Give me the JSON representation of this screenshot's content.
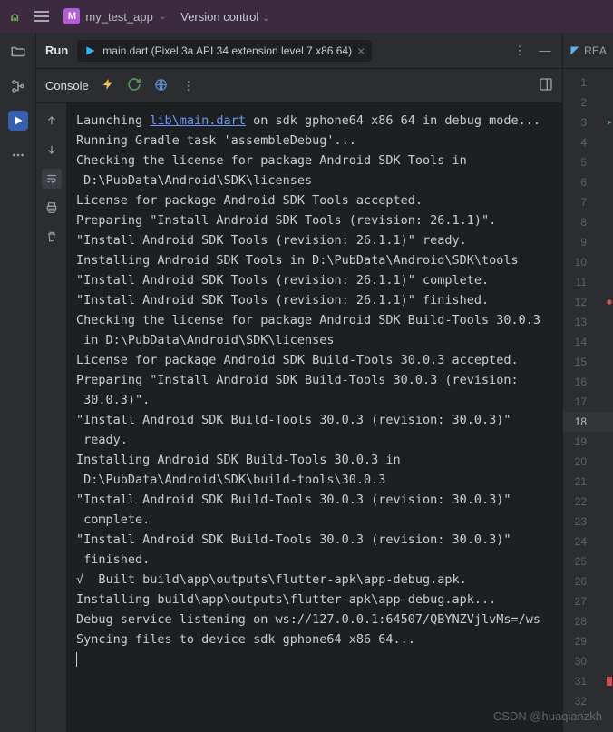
{
  "topbar": {
    "project_initial": "M",
    "project_name": "my_test_app",
    "version_control": "Version control"
  },
  "tab": {
    "run_label": "Run",
    "file_label": "main.dart (Pixel 3a API 34 extension level 7 x86 64)"
  },
  "subbar": {
    "console_label": "Console"
  },
  "right": {
    "header": "REA"
  },
  "gutter": {
    "lines": [
      "1",
      "2",
      "3",
      "4",
      "5",
      "6",
      "7",
      "8",
      "9",
      "10",
      "11",
      "12",
      "13",
      "14",
      "15",
      "16",
      "17",
      "18",
      "19",
      "20",
      "21",
      "22",
      "23",
      "24",
      "25",
      "26",
      "27",
      "28",
      "29",
      "30",
      "31",
      "32"
    ],
    "highlight": 18,
    "run_marker_at": 3,
    "breakpoint_at": 12,
    "red_marker_at": 31
  },
  "console": {
    "link_text": "lib\\main.dart",
    "pre_link": "Launching ",
    "post_link": " on sdk gphone64 x86 64 in debug mode...",
    "lines": [
      "Running Gradle task 'assembleDebug'...",
      "Checking the license for package Android SDK Tools in",
      " D:\\PubData\\Android\\SDK\\licenses",
      "License for package Android SDK Tools accepted.",
      "Preparing \"Install Android SDK Tools (revision: 26.1.1)\".",
      "\"Install Android SDK Tools (revision: 26.1.1)\" ready.",
      "Installing Android SDK Tools in D:\\PubData\\Android\\SDK\\tools",
      "\"Install Android SDK Tools (revision: 26.1.1)\" complete.",
      "\"Install Android SDK Tools (revision: 26.1.1)\" finished.",
      "Checking the license for package Android SDK Build-Tools 30.0.3",
      " in D:\\PubData\\Android\\SDK\\licenses",
      "License for package Android SDK Build-Tools 30.0.3 accepted.",
      "Preparing \"Install Android SDK Build-Tools 30.0.3 (revision:",
      " 30.0.3)\".",
      "\"Install Android SDK Build-Tools 30.0.3 (revision: 30.0.3)\"",
      " ready.",
      "Installing Android SDK Build-Tools 30.0.3 in",
      " D:\\PubData\\Android\\SDK\\build-tools\\30.0.3",
      "\"Install Android SDK Build-Tools 30.0.3 (revision: 30.0.3)\"",
      " complete.",
      "\"Install Android SDK Build-Tools 30.0.3 (revision: 30.0.3)\"",
      " finished.",
      "√  Built build\\app\\outputs\\flutter-apk\\app-debug.apk.",
      "Installing build\\app\\outputs\\flutter-apk\\app-debug.apk...",
      "Debug service listening on ws://127.0.0.1:64507/QBYNZVjlvMs=/ws",
      "Syncing files to device sdk gphone64 x86 64..."
    ]
  },
  "watermark": "CSDN @huaqianzkh"
}
